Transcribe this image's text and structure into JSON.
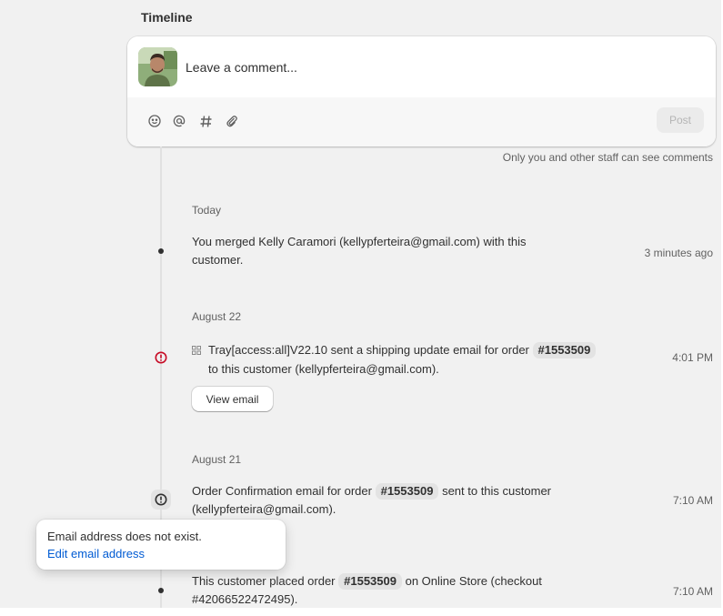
{
  "timeline": {
    "title": "Timeline"
  },
  "comment": {
    "placeholder": "Leave a comment...",
    "tools": [
      "emoji-icon",
      "mention-icon",
      "hashtag-icon",
      "attachment-icon"
    ],
    "post_label": "Post",
    "staff_note": "Only you and other staff can see comments"
  },
  "groups": [
    {
      "date": "Today",
      "events": [
        {
          "text_line1": "You merged Kelly Caramori (kellypferteira@gmail.com) with this",
          "text_line2": "customer.",
          "time": "3 minutes ago"
        }
      ]
    },
    {
      "date": "August 22",
      "events": [
        {
          "app_icon": "app-icon",
          "pre": "Tray[access:all]V22.10 sent a shipping update email for order",
          "order": "#1553509",
          "line2": "to this customer (kellypferteira@gmail.com).",
          "time": "4:01 PM",
          "button": "View email",
          "status_icon": "alert-circle-icon"
        }
      ]
    },
    {
      "date": "August 21",
      "events": [
        {
          "pre": "Order Confirmation email for order",
          "order": "#1553509",
          "post": "sent to this customer",
          "line2": "(kellypferteira@gmail.com).",
          "time": "7:10 AM",
          "status_icon": "alert-circle-icon"
        },
        {
          "pre": "This customer placed order",
          "order": "#1553509",
          "post": "on Online Store (checkout",
          "line2": "#42066522472495).",
          "time": "7:10 AM"
        }
      ]
    }
  ],
  "tooltip": {
    "message": "Email address does not exist.",
    "link": "Edit email address"
  },
  "colors": {
    "alert": "#c70a24",
    "link": "#005bd3",
    "tag_bg": "#e3e3e3"
  }
}
